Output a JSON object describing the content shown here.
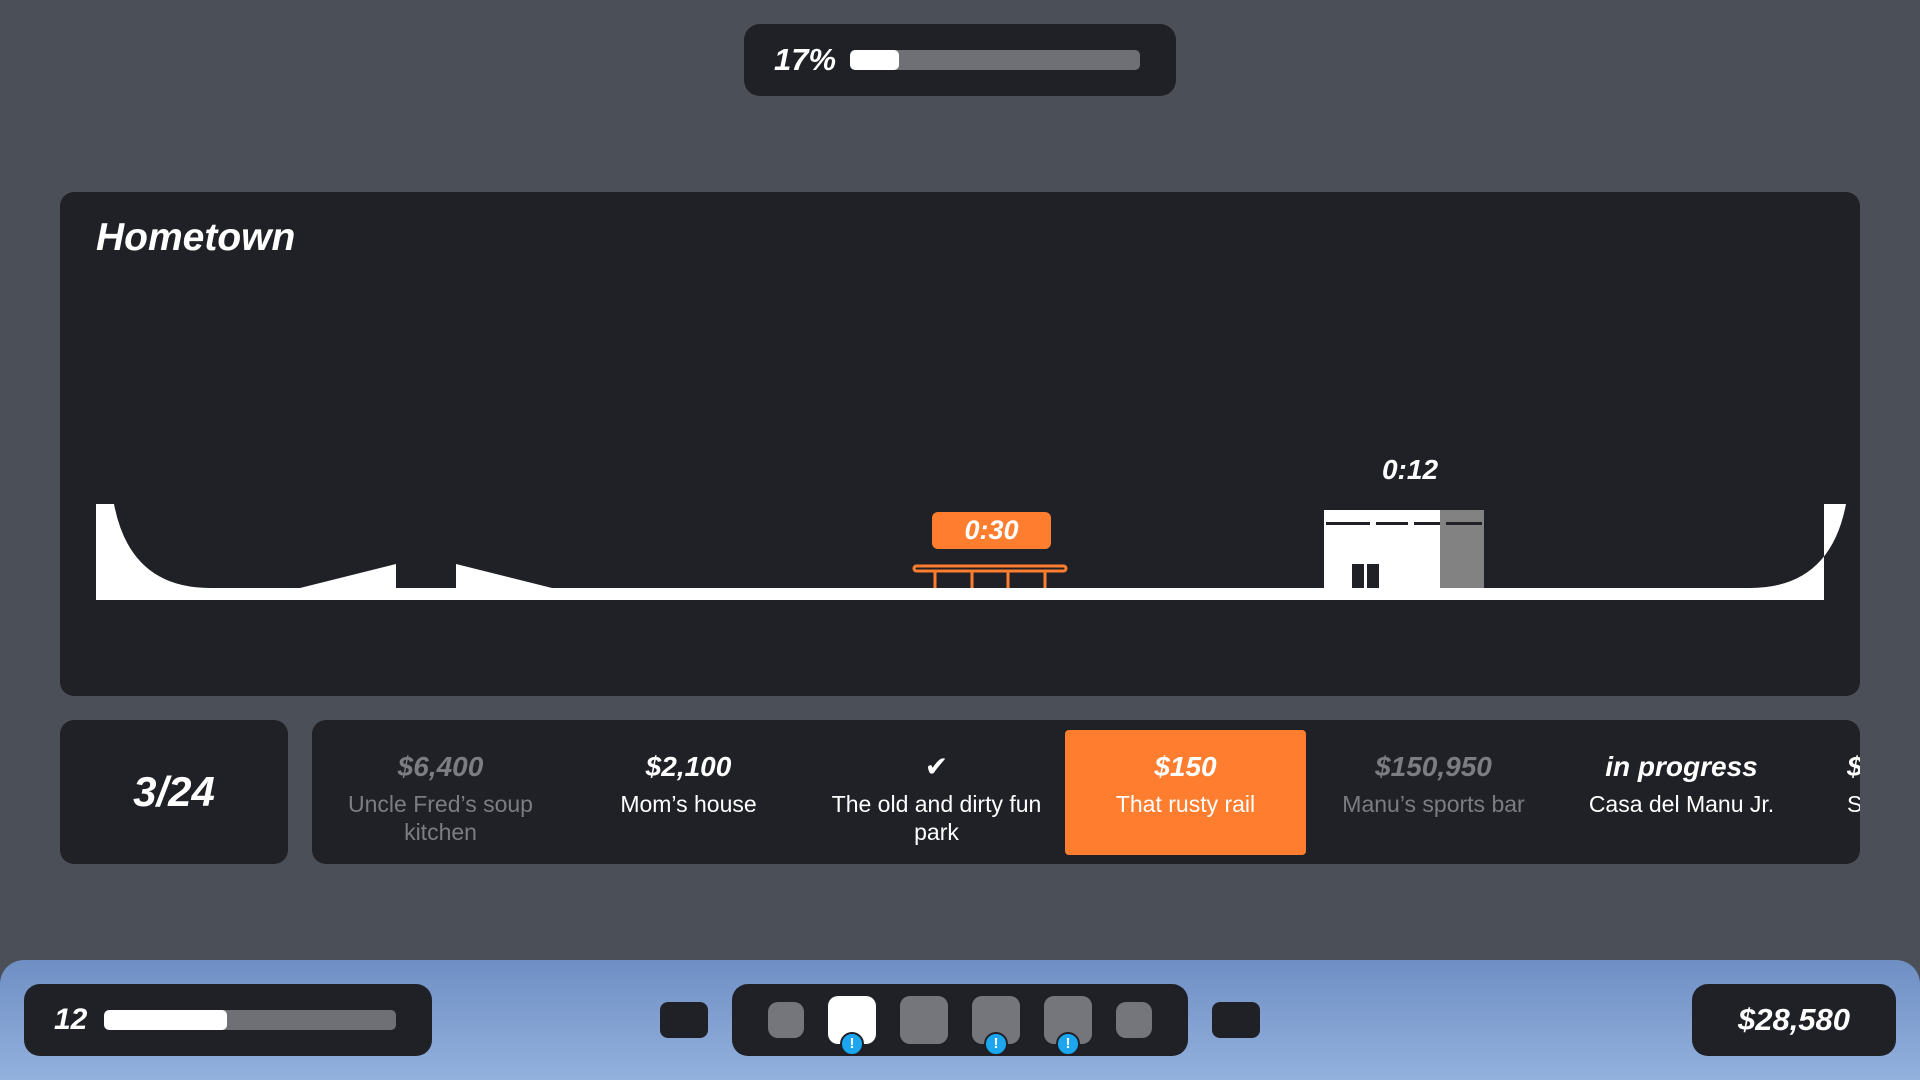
{
  "top_progress": {
    "percent_label": "17%",
    "fraction": 0.17
  },
  "map": {
    "title": "Hometown",
    "rail_timer": "0:30",
    "building_timer": "0:12",
    "colors": {
      "ground": "#ffffff",
      "accent": "#ff7d2f",
      "panel": "#202127",
      "building_shade": "#828282"
    }
  },
  "level_counter": "3/24",
  "spots": [
    {
      "value": "$6,400",
      "name": "Uncle Fred’s soup kitchen",
      "state": "locked"
    },
    {
      "value": "$2,100",
      "name": "Mom’s house",
      "state": "available"
    },
    {
      "value": "✔",
      "name": "The old and dirty fun park",
      "state": "done"
    },
    {
      "value": "$150",
      "name": "That rusty rail",
      "state": "selected"
    },
    {
      "value": "$150,950",
      "name": "Manu’s sports bar",
      "state": "locked"
    },
    {
      "value": "in progress",
      "name": "Casa del Manu Jr.",
      "state": "in-progress"
    },
    {
      "value": "$",
      "name": "S",
      "state": "partial"
    }
  ],
  "bottom": {
    "level": "12",
    "xp_fraction": 0.42,
    "money": "$28,580",
    "alert_glyph": "!",
    "accent_alert": "#1ba6ef"
  }
}
